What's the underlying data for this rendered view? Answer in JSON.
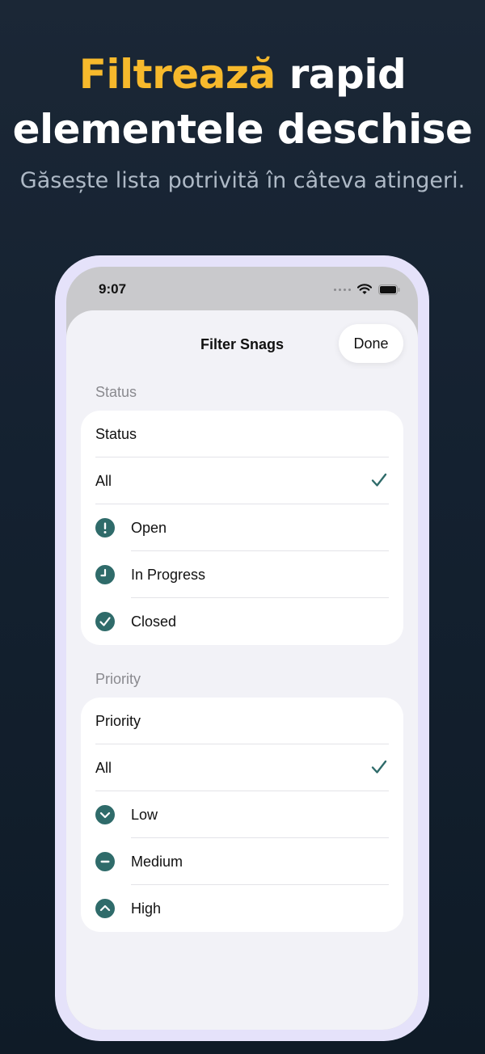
{
  "hero": {
    "title_accent": "Filtrează",
    "title_rest_line1": " rapid",
    "title_line2": "elementele deschise",
    "subtitle": "Găsește lista potrivită în câteva atingeri."
  },
  "status_bar": {
    "time": "9:07"
  },
  "sheet": {
    "title": "Filter Snags",
    "done_label": "Done"
  },
  "status_section": {
    "header": "Status",
    "picker_label": "Status",
    "options": [
      {
        "label": "All",
        "icon": "none",
        "selected": true
      },
      {
        "label": "Open",
        "icon": "exclamation-icon",
        "selected": false
      },
      {
        "label": "In Progress",
        "icon": "clock-icon",
        "selected": false
      },
      {
        "label": "Closed",
        "icon": "checkmark-circle-icon",
        "selected": false
      }
    ]
  },
  "priority_section": {
    "header": "Priority",
    "picker_label": "Priority",
    "options": [
      {
        "label": "All",
        "icon": "none",
        "selected": true
      },
      {
        "label": "Low",
        "icon": "chevron-down-circle-icon",
        "selected": false
      },
      {
        "label": "Medium",
        "icon": "minus-circle-icon",
        "selected": false
      },
      {
        "label": "High",
        "icon": "chevron-up-circle-icon",
        "selected": false
      }
    ]
  },
  "colors": {
    "accent": "#f7b92c",
    "teal": "#2f6b6a",
    "background": "#142130",
    "frame": "#e5e2fa"
  }
}
